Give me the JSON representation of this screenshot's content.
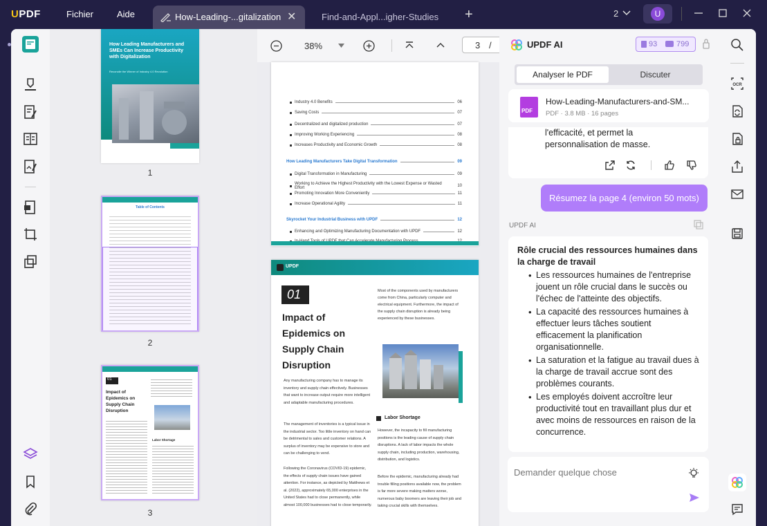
{
  "app": {
    "logo_u": "U",
    "logo_rest": "PDF"
  },
  "menu": {
    "file": "Fichier",
    "help": "Aide"
  },
  "tabs": [
    {
      "label": "How-Leading-...gitalization",
      "active": true
    },
    {
      "label": "Find-and-Appl...igher-Studies",
      "active": false
    }
  ],
  "window": {
    "count": "2",
    "user_initial": "U"
  },
  "viewer": {
    "zoom": "38%",
    "page_current": "3",
    "page_sep": "/"
  },
  "thumbnails": [
    {
      "number": "1",
      "title": "How Leading Manufacturers and SMEs Can Increase Productivity with Digitalization",
      "subtitle": "Reconcile the Winner of Industry 4.0 Revolution"
    },
    {
      "number": "2",
      "title": "Table of Contents"
    },
    {
      "number": "3",
      "section": "01",
      "title": "Impact of Epidemics on Supply Chain Disruption",
      "subhead": "Labor Shortage"
    }
  ],
  "page2": {
    "toc": [
      {
        "label": "Industry 4.0 Benefits",
        "page": "06",
        "head": false
      },
      {
        "label": "Saving Costs",
        "page": "07",
        "head": false
      },
      {
        "label": "Decentralized and digitalized production",
        "page": "07",
        "head": false
      },
      {
        "label": "Improving Working Experiencing",
        "page": "08",
        "head": false
      },
      {
        "label": "Increases Productivity and Economic Growth",
        "page": "08",
        "head": false
      },
      {
        "label": "How Leading Manufacturers Take Digital Transformation",
        "page": "09",
        "head": true
      },
      {
        "label": "Digital Transformation in Manufacturing",
        "page": "09",
        "head": false
      },
      {
        "label": "Working to Achieve the Highest Productivity with the Lowest Expense or Wasted Effort",
        "page": "10",
        "head": false
      },
      {
        "label": "Promoting Innovation More Conveniently",
        "page": "11",
        "head": false
      },
      {
        "label": "Increase Operational Agility",
        "page": "11",
        "head": false
      },
      {
        "label": "Skyrocket Your Industrial Business with UPDF",
        "page": "12",
        "head": true
      },
      {
        "label": "Enhancing and Optimizing Manufacturing Documentation with UPDF",
        "page": "12",
        "head": false
      },
      {
        "label": "In-Hand Tools of UPDF that Can Accelerate Manufacturing Process",
        "page": "12",
        "head": false
      }
    ]
  },
  "page3": {
    "brand": "UPDF",
    "section": "01",
    "title": "Impact of Epidemics on Supply Chain Disruption",
    "col_right_intro": "Most of the components used by manufacturers come from China, particularly computer and electrical equipment. Furthermore, the impact of the supply chain disruption is already being experienced by these businesses.",
    "p1": "Any manufacturing company has to manage its inventory and supply chain effectively. Businesses that want to increase output require more intelligent and adaptable manufacturing procedures.",
    "p2": "The management of inventories is a typical issue in the industrial sector. Too little inventory on hand can be detrimental to sales and customer relations. A surplus of inventory may be expensive to store and can be challenging to vend.",
    "p3": "Following the Coronavirus (COVID-19) epidemic, the effects of supply chain issues have gained attention. For instance, as depicted by Matthews et al. (2022), approximately 65,000 enterprises in the United States had to close permanently, while almost 100,000 businesses had to close temporarily.",
    "subhead": "Labor Shortage",
    "p4": "However, the incapacity to fill manufacturing positions is the leading cause of supply chain disruptions. A lack of labor impacts the whole supply chain, including production, warehousing, distribution, and logistics.",
    "p5": "Before the epidemic, manufacturing already had trouble filling positions available now, the problem is far more severe making matters worse, numerous baby boomers are leaving their job and taking crucial skills with themselves."
  },
  "ai": {
    "title": "UPDF AI",
    "credits_pdf": "93",
    "credits_chat": "799",
    "tab_analyze": "Analyser le PDF",
    "tab_chat": "Discuter",
    "file_name": "How-Leading-Manufacturers-and-SM...",
    "file_meta": "PDF · 3.8 MB · 16 pages",
    "file_badge": "PDF",
    "prev_text": "l'efficacité, et permet la personnalisation de masse.",
    "user_msg": "Résumez la page 4 (environ 50 mots)",
    "bot_label": "UPDF AI",
    "answer_title": "Rôle crucial des ressources humaines dans la charge de travail",
    "bullets": [
      "Les ressources humaines de l'entreprise jouent un rôle crucial dans le succès ou l'échec de l'atteinte des objectifs.",
      "La capacité des ressources humaines à effectuer leurs tâches soutient efficacement la planification organisationnelle.",
      "La saturation et la fatigue au travail dues à la charge de travail accrue sont des problèmes courants.",
      "Les employés doivent accroître leur productivité tout en travaillant plus dur et avec moins de ressources en raison de la concurrence."
    ],
    "input_placeholder": "Demander quelque chose"
  },
  "colors": {
    "accent": "#8a4bd8",
    "user_bubble": "#b07dfa",
    "teal": "#1aa39a",
    "titlebar": "#221f44"
  }
}
